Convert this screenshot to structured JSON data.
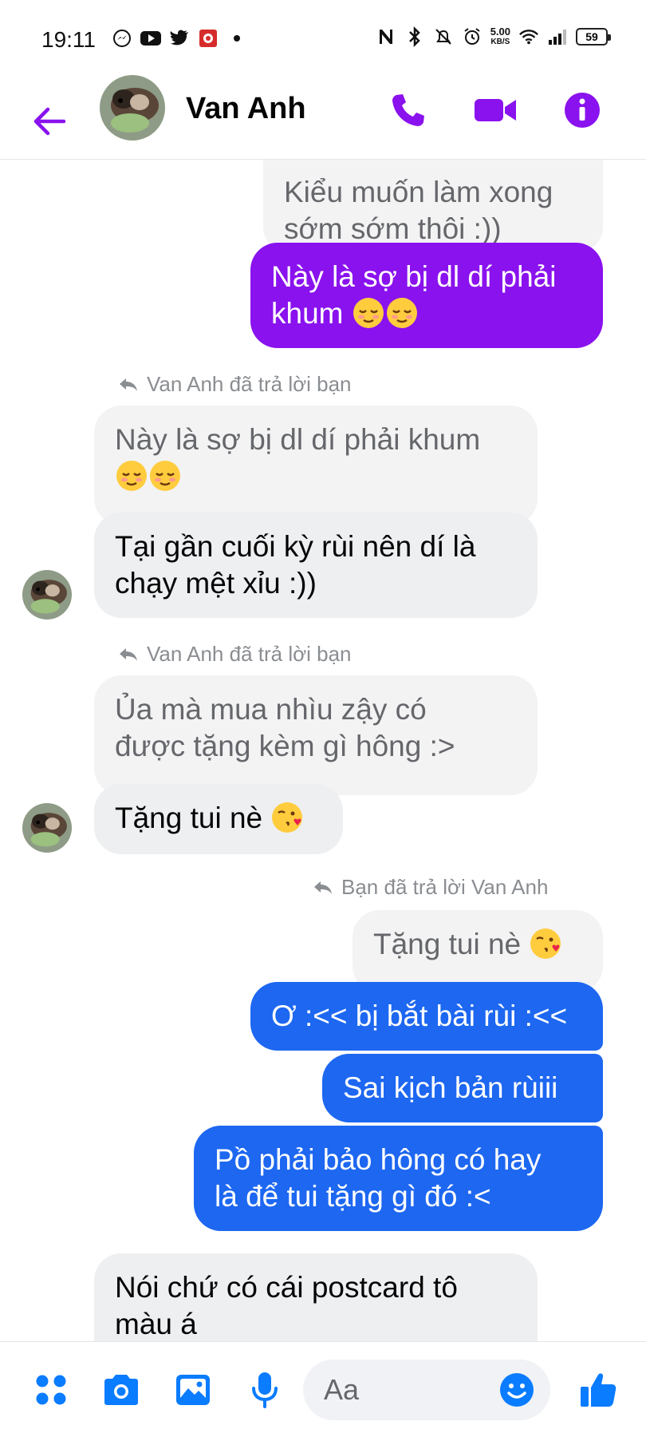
{
  "status_bar": {
    "time": "19:11",
    "net_speed_value": "5.00",
    "net_speed_unit": "KB/S",
    "battery": "59"
  },
  "header": {
    "contact_name": "Van Anh"
  },
  "colors": {
    "accent": "#8a12ee",
    "out_purple": "#8a12ee",
    "out_blue": "#1d67f1",
    "in_bubble": "#eeeff1",
    "messenger_blue": "#0a7cff"
  },
  "messages": {
    "m1": {
      "line1": "Kiểu muốn làm xong",
      "line2": "sớm sớm thôi :))"
    },
    "m2": {
      "line1": "Này là sợ bị dl dí phải",
      "line2": "khum"
    },
    "reply1": "Van Anh đã trả lời bạn",
    "q1": {
      "line1": "Này là sợ bị dl dí phải khum"
    },
    "m3": {
      "line1": "Tại gần cuối kỳ rùi nên dí là",
      "line2": "chạy mệt xỉu :))"
    },
    "reply2": "Van Anh đã trả lời bạn",
    "q2": {
      "line1": "Ủa mà mua nhìu zậy có",
      "line2": "được tặng kèm gì hông :>"
    },
    "m4": {
      "text": "Tặng tui nè"
    },
    "reply3": "Bạn đã trả lời Van Anh",
    "q3": {
      "text": "Tặng tui nè"
    },
    "m5": {
      "text": "Ơ :<< bị bắt bài rùi :<<"
    },
    "m6": {
      "text": "Sai kịch bản rùiii"
    },
    "m7": {
      "line1": "Pồ phải bảo hông có hay",
      "line2": "là để tui tặng gì đó :<"
    },
    "m8": {
      "line1": "Nói chứ có cái postcard tô",
      "line2": "màu á"
    }
  },
  "composer": {
    "placeholder": "Aa"
  },
  "icons": [
    "back-arrow-icon",
    "phone-icon",
    "video-icon",
    "info-icon",
    "menu-dots-icon",
    "camera-icon",
    "image-icon",
    "mic-icon",
    "emoji-icon",
    "thumbs-up-icon",
    "reply-arrow-icon"
  ]
}
